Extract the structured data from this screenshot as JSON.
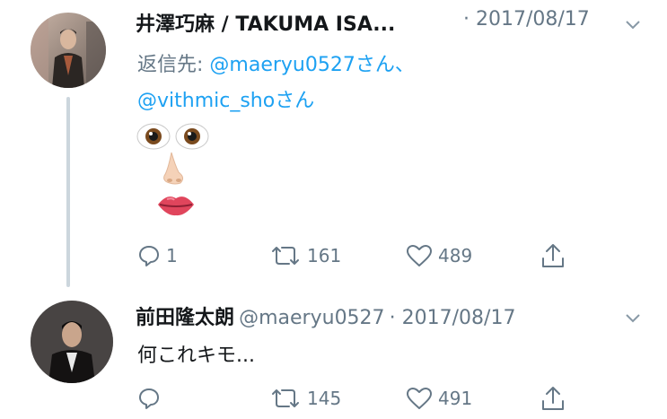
{
  "tweet1": {
    "author_name": "井澤巧麻 / TAKUMA ISA...",
    "date": "· 2017/08/17",
    "reply_prefix": "返信先: ",
    "reply_mention1": "@maeryu0527さん、",
    "reply_mention2": "@vithmic_shoさん",
    "reply_count": "1",
    "retweet_count": "161",
    "like_count": "489",
    "avatar": "avatar-photo-person-street",
    "emoji_eyes": "👁👁",
    "emoji_nose": "👃",
    "emoji_mouth": "👄"
  },
  "tweet2": {
    "author_name": "前田隆太朗",
    "handle": "@maeryu0527",
    "date": "· 2017/08/17",
    "text": "何これキモ...",
    "reply_count": "",
    "retweet_count": "145",
    "like_count": "491",
    "avatar": "avatar-photo-person-dark"
  },
  "colors": {
    "link": "#1da1f2",
    "muted": "#657786",
    "text": "#14171a",
    "thread_line": "#ccd6dd"
  },
  "icons": [
    "reply-icon",
    "retweet-icon",
    "like-icon",
    "share-icon",
    "chevron-down-icon"
  ]
}
